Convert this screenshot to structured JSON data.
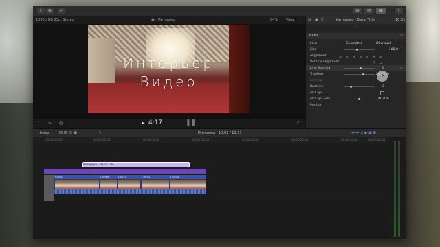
{
  "viewer": {
    "format_label": "1080p HD 25p, Stereo",
    "project_name": "Интерьер",
    "zoom": "64%",
    "view_menu": "View",
    "title_line1": "Интерьер",
    "title_line2": "Видео",
    "timecode": "4:17"
  },
  "inspector": {
    "header_title": "Интерьер - Basic Title",
    "header_time": "10:01",
    "section": "Basic",
    "font_label": "Font",
    "font_value": "Geometria",
    "font_style": "Обычный",
    "size_label": "Size",
    "size_value": "180,0",
    "alignment_label": "Alignment",
    "valign_label": "Vertical Alignment",
    "linespacing_label": "Line Spacing",
    "linespacing_value": "0",
    "tracking_label": "Tracking",
    "tracking_value": "24,02 %",
    "kerning_label": "Kerning",
    "baseline_label": "Baseline",
    "baseline_value": "0",
    "allcaps_label": "All Caps",
    "allcapssize_label": "All Caps Size",
    "allcapssize_value": "80,0 %",
    "position_label": "Position"
  },
  "timeline": {
    "index_label": "Index",
    "project_label": "Интерьер",
    "duration": "10:01 / 15:11",
    "ruler": [
      "00:00:00:00",
      "00:00:05:00",
      "00:00:10:00",
      "00:00:15:00",
      "00:00:20:00",
      "00:00:25:00",
      "00:00:30:00",
      "00:00:35:00"
    ],
    "title_clip": "Интерьер - Basic Title",
    "clips": [
      "C0067",
      "C0069",
      "C0070",
      "C0073",
      "C0074"
    ]
  }
}
